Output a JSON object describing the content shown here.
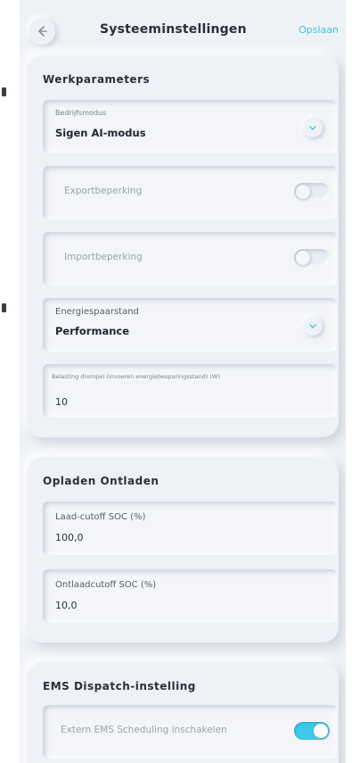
{
  "header": {
    "title": "Systeeminstellingen",
    "save_label": "Opslaan"
  },
  "work_params": {
    "title": "Werkparameters",
    "mode_label": "Bedrijfsmodus",
    "mode_value": "Sigen AI-modus",
    "export_limit_label": "Exportbeperking",
    "export_limit_on": false,
    "import_limit_label": "Importbeperking",
    "import_limit_on": false,
    "energy_saving_label": "Energiespaarstand",
    "energy_saving_value": "Performance",
    "load_threshold_label": "Belasting drempel (invoeren energiebesparingsstand) (W)",
    "load_threshold_value": "10"
  },
  "charge_discharge": {
    "title": "Opladen Ontladen",
    "charge_cutoff_label": "Laad-cutoff SOC (%)",
    "charge_cutoff_value": "100,0",
    "discharge_cutoff_label": "Ontlaadcutoff SOC (%)",
    "discharge_cutoff_value": "10,0"
  },
  "ems": {
    "title": "EMS Dispatch-instelling",
    "external_label": "Extern EMS Scheduling inschakelen",
    "external_on": true
  },
  "colors": {
    "accent": "#3cc8e6",
    "background": "#eef1f6"
  },
  "icons": {
    "back": "arrow-left-icon",
    "dropdown": "chevron-down-icon"
  }
}
